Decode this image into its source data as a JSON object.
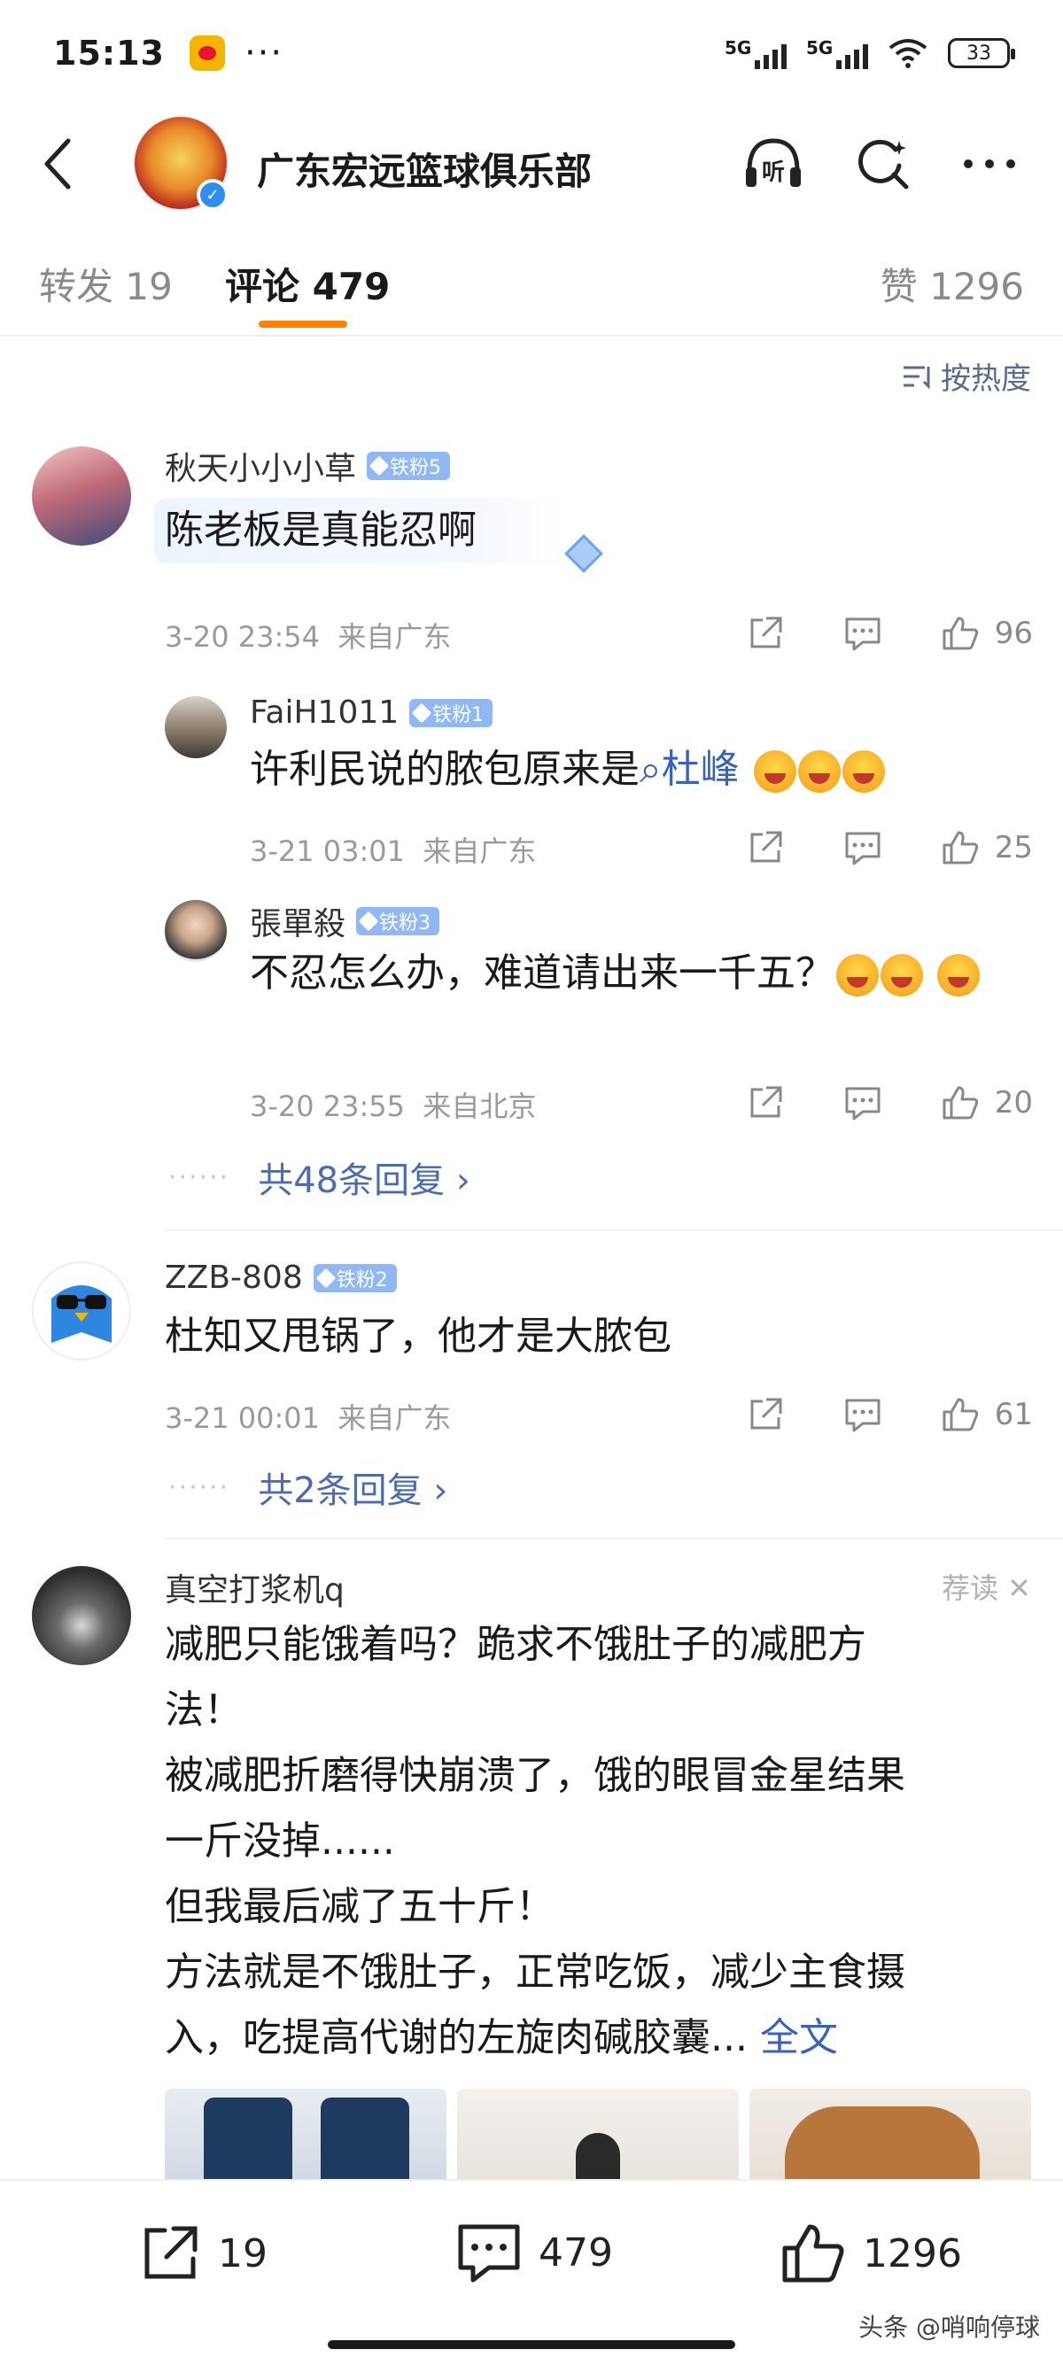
{
  "status_bar": {
    "time": "15:13",
    "dots": "···",
    "net1": "5G",
    "net2": "5G",
    "battery": "33"
  },
  "header": {
    "title": "广东宏远篮球俱乐部",
    "verified": "✓"
  },
  "tabs": [
    {
      "label": "转发 19"
    },
    {
      "label": "评论 479"
    },
    {
      "label": "赞 1296"
    }
  ],
  "sort": {
    "label": "按热度"
  },
  "comments": [
    {
      "user": "秋天小小小草",
      "badge": "铁粉5",
      "text": "陈老板是真能忍啊",
      "time": "3-20 23:54",
      "location": "来自广东",
      "likes": "96"
    },
    {
      "user": "FaiH1011",
      "badge": "铁粉1",
      "text_prefix": "许利民说的脓包原来是",
      "topic": "杜峰",
      "time": "3-21 03:01",
      "location": "来自广东",
      "likes": "25"
    },
    {
      "user": "張單殺",
      "badge": "铁粉3",
      "text": "不忍怎么办，难道请出来一千五？",
      "time": "3-20 23:55",
      "location": "来自北京",
      "likes": "20"
    },
    {
      "user": "ZZB-808",
      "badge": "铁粉2",
      "text": "杜知又甩锅了，他才是大脓包",
      "time": "3-21 00:01",
      "location": "来自广东",
      "likes": "61"
    }
  ],
  "more_replies": [
    {
      "label": "共48条回复 ›"
    },
    {
      "label": "共2条回复 ›"
    }
  ],
  "ad": {
    "user": "真空打浆机q",
    "tag": "荐读 ✕",
    "lines": [
      "减肥只能饿着吗？跪求不饿肚子的减肥方",
      "法！",
      "被减肥折磨得快崩溃了，饿的眼冒金星结果",
      "一斤没掉......",
      "但我最后减了五十斤！",
      "方法就是不饿肚子，正常吃饭，减少主食摄",
      "入，吃提高代谢的左旋肉碱胶囊..."
    ],
    "full_text": "全文"
  },
  "bottom_bar": {
    "repost": "19",
    "comment": "479",
    "like": "1296"
  },
  "watermark": "头条 @哨响停球",
  "colors": {
    "accent": "#ff8200",
    "link": "#3a62b8",
    "badge": "#8fb8f4"
  }
}
